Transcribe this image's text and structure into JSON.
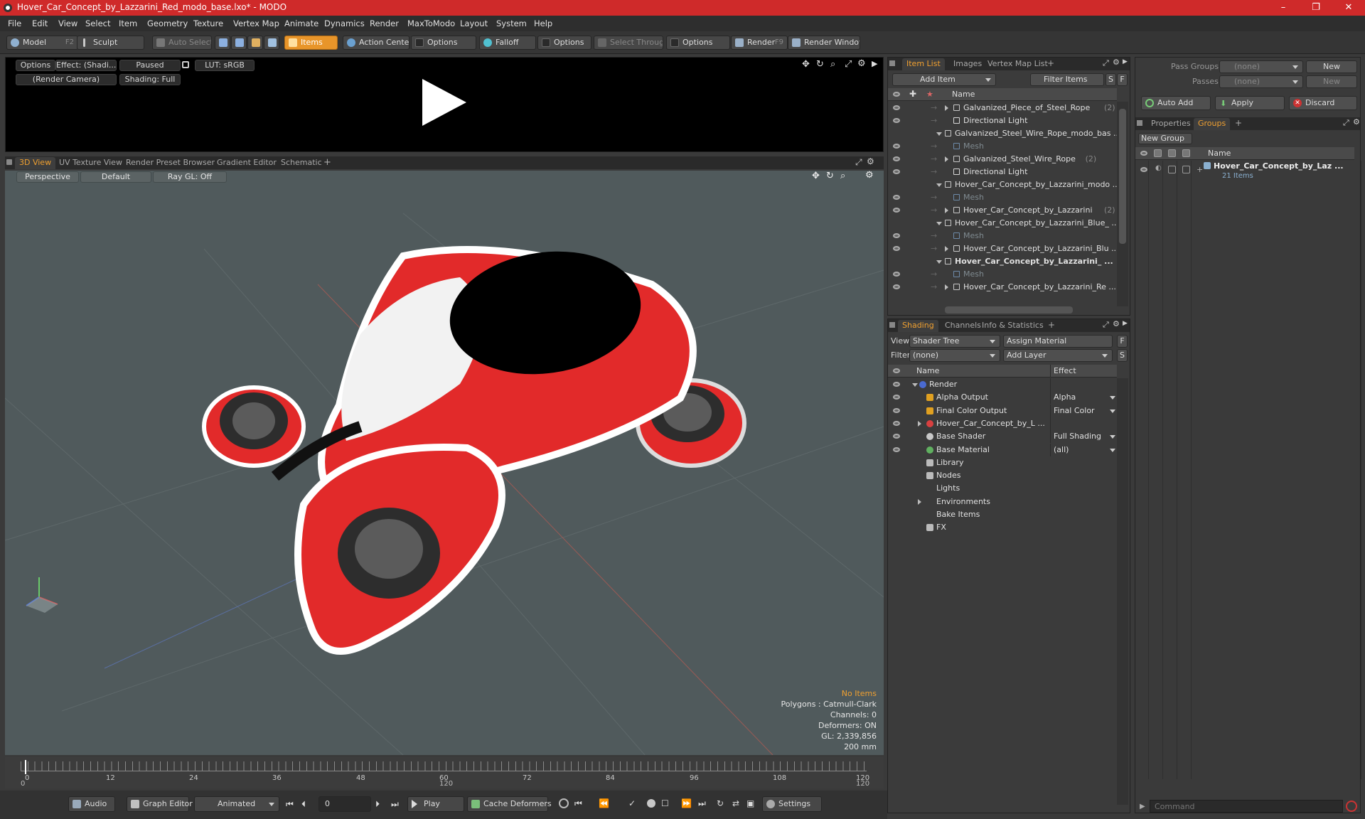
{
  "window": {
    "title": "Hover_Car_Concept_by_Lazzarini_Red_modo_base.lxo* - MODO"
  },
  "menu": [
    "File",
    "Edit",
    "View",
    "Select",
    "Item",
    "Geometry",
    "Texture",
    "Vertex Map",
    "Animate",
    "Dynamics",
    "Render",
    "MaxToModo",
    "Layout",
    "System",
    "Help"
  ],
  "toolbar": {
    "model": "Model",
    "model_key": "F2",
    "sculpt": "Sculpt",
    "auto_select": "Auto Select",
    "items": "Items",
    "action_center": "Action Center",
    "options1": "Options",
    "falloff": "Falloff",
    "options2": "Options",
    "select_through": "Select Through",
    "options3": "Options",
    "render": "Render",
    "render_key": "F9",
    "render_window": "Render Window"
  },
  "preview": {
    "options": "Options",
    "effect": "Effect: (Shadi...",
    "paused": "Paused",
    "lut": "LUT: sRGB",
    "camera": "(Render Camera)",
    "shading": "Shading: Full"
  },
  "view_tabs": [
    "3D View",
    "UV Texture View",
    "Render Preset Browser",
    "Gradient Editor",
    "Schematic"
  ],
  "viewport": {
    "perspective": "Perspective",
    "default": "Default",
    "raygl": "Ray GL: Off",
    "info": {
      "items": "No Items",
      "polygons": "Polygons : Catmull-Clark",
      "channels": "Channels: 0",
      "deformers": "Deformers: ON",
      "gl": "GL: 2,339,856",
      "scale": "200 mm"
    }
  },
  "timeline": {
    "ticks": [
      "0",
      "12",
      "24",
      "36",
      "48",
      "60",
      "72",
      "84",
      "96",
      "108",
      "120"
    ],
    "start": "0",
    "mid": "120",
    "end": "120"
  },
  "bottombar": {
    "audio": "Audio",
    "graph_editor": "Graph Editor",
    "animated": "Animated",
    "frame": "0",
    "play": "Play",
    "cache": "Cache Deformers",
    "settings": "Settings"
  },
  "item_list": {
    "tabs": [
      "Item List",
      "Images",
      "Vertex Map List"
    ],
    "add_item": "Add Item",
    "filter_items": "Filter Items",
    "s": "S",
    "f": "F",
    "col_name": "Name",
    "rows": [
      {
        "label": "Galvanized_Piece_of_Steel_Rope",
        "count": "(2)",
        "indent": 3,
        "kind": "folder"
      },
      {
        "label": "Directional Light",
        "count": "",
        "indent": 3,
        "kind": "light"
      },
      {
        "label": "Galvanized_Steel_Wire_Rope_modo_bas ...",
        "count": "",
        "indent": 2,
        "kind": "scene"
      },
      {
        "label": "Mesh",
        "count": "",
        "indent": 3,
        "kind": "mesh"
      },
      {
        "label": "Galvanized_Steel_Wire_Rope",
        "count": "(2)",
        "indent": 3,
        "kind": "folder"
      },
      {
        "label": "Directional Light",
        "count": "",
        "indent": 3,
        "kind": "light"
      },
      {
        "label": "Hover_Car_Concept_by_Lazzarini_modo ...",
        "count": "",
        "indent": 2,
        "kind": "scene"
      },
      {
        "label": "Mesh",
        "count": "",
        "indent": 3,
        "kind": "mesh"
      },
      {
        "label": "Hover_Car_Concept_by_Lazzarini",
        "count": "(2)",
        "indent": 3,
        "kind": "folder"
      },
      {
        "label": "Hover_Car_Concept_by_Lazzarini_Blue_ ...",
        "count": "",
        "indent": 2,
        "kind": "scene"
      },
      {
        "label": "Mesh",
        "count": "",
        "indent": 3,
        "kind": "mesh"
      },
      {
        "label": "Hover_Car_Concept_by_Lazzarini_Blu ...",
        "count": "",
        "indent": 3,
        "kind": "folder"
      },
      {
        "label": "Hover_Car_Concept_by_Lazzarini_ ...",
        "count": "",
        "indent": 2,
        "kind": "scene-bold"
      },
      {
        "label": "Mesh",
        "count": "",
        "indent": 3,
        "kind": "mesh"
      },
      {
        "label": "Hover_Car_Concept_by_Lazzarini_Re ...",
        "count": "",
        "indent": 3,
        "kind": "folder"
      }
    ]
  },
  "shading": {
    "tabs": [
      "Shading",
      "Channels",
      "Info & Statistics"
    ],
    "view_label": "View",
    "view_value": "Shader Tree",
    "assign_material": "Assign Material",
    "f": "F",
    "filter_label": "Filter",
    "filter_value": "(none)",
    "add_layer": "Add Layer",
    "s": "S",
    "col_name": "Name",
    "col_effect": "Effect",
    "rows": [
      {
        "label": "Render",
        "effect": "",
        "indent": 0,
        "eye": true
      },
      {
        "label": "Alpha Output",
        "effect": "Alpha",
        "indent": 1,
        "eye": true
      },
      {
        "label": "Final Color Output",
        "effect": "Final Color",
        "indent": 1,
        "eye": true
      },
      {
        "label": "Hover_Car_Concept_by_L ...",
        "effect": "",
        "indent": 1,
        "eye": true
      },
      {
        "label": "Base Shader",
        "effect": "Full Shading",
        "indent": 1,
        "eye": true
      },
      {
        "label": "Base Material",
        "effect": "(all)",
        "indent": 1,
        "eye": true
      },
      {
        "label": "Library",
        "effect": "",
        "indent": 1,
        "eye": false
      },
      {
        "label": "Nodes",
        "effect": "",
        "indent": 1,
        "eye": false
      },
      {
        "label": "Lights",
        "effect": "",
        "indent": 1,
        "eye": false
      },
      {
        "label": "Environments",
        "effect": "",
        "indent": 1,
        "eye": false
      },
      {
        "label": "Bake Items",
        "effect": "",
        "indent": 1,
        "eye": false
      },
      {
        "label": "FX",
        "effect": "",
        "indent": 1,
        "eye": false
      }
    ]
  },
  "pass_groups": {
    "label": "Pass Groups",
    "value": "(none)",
    "new": "New",
    "passes_label": "Passes",
    "passes_value": "(none)",
    "passes_new": "New"
  },
  "actions": {
    "auto_add": "Auto Add",
    "apply": "Apply",
    "discard": "Discard"
  },
  "groups": {
    "tabs": [
      "Properties",
      "Groups"
    ],
    "new_group": "New Group",
    "col_name": "Name",
    "item": "Hover_Car_Concept_by_Laz ...",
    "items_count": "21 Items"
  },
  "command": {
    "placeholder": "Command"
  },
  "colors": {
    "accent": "#f0a030",
    "title_red": "#cf2a2a",
    "car_red": "#e02828"
  }
}
